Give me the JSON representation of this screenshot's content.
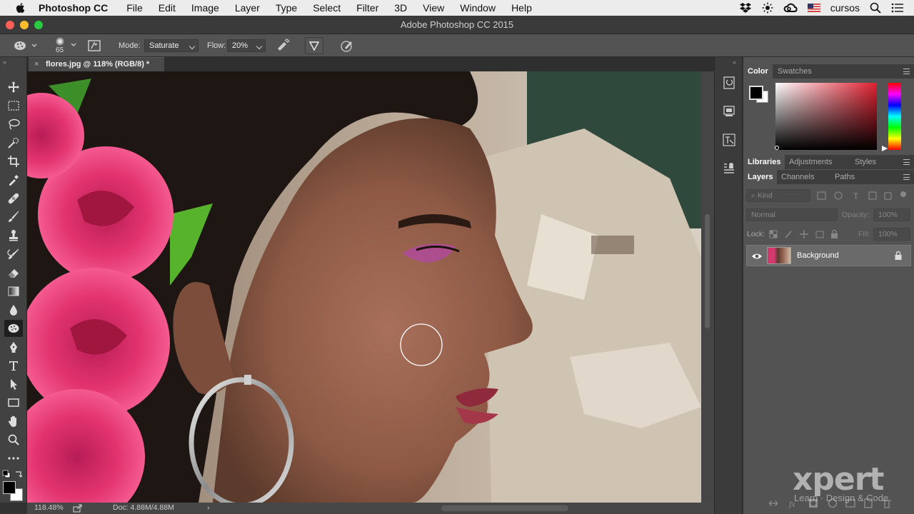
{
  "menubar": {
    "app_name": "Photoshop CC",
    "items": [
      "File",
      "Edit",
      "Image",
      "Layer",
      "Type",
      "Select",
      "Filter",
      "3D",
      "View",
      "Window",
      "Help"
    ],
    "user": "cursos"
  },
  "window": {
    "title": "Adobe Photoshop CC 2015"
  },
  "options_bar": {
    "brush_size": "65",
    "mode_label": "Mode:",
    "mode_value": "Saturate",
    "flow_label": "Flow:",
    "flow_value": "20%"
  },
  "document": {
    "tab_title": "flores.jpg @ 118% (RGB/8) *",
    "close_glyph": "×"
  },
  "status_bar": {
    "zoom": "118.48%",
    "doc_size": "Doc: 4.88M/4.88M",
    "arrow": "›"
  },
  "color_panel": {
    "tabs": [
      "Color",
      "Swatches"
    ],
    "foreground": "#000000",
    "background": "#ffffff",
    "hue": "#e02030"
  },
  "libraries_panel": {
    "tabs": [
      "Libraries",
      "Adjustments",
      "Styles"
    ]
  },
  "layers_panel": {
    "tabs": [
      "Layers",
      "Channels",
      "Paths"
    ],
    "filter_placeholder": "Kind",
    "blend_mode": "Normal",
    "opacity_label": "Opacity:",
    "opacity_value": "100%",
    "lock_label": "Lock:",
    "fill_label": "Fill:",
    "fill_value": "100%",
    "layers": [
      {
        "name": "Background",
        "visible": true,
        "locked": true
      }
    ]
  },
  "watermark": {
    "brand": "xpert",
    "tagline": "Learn · Design & Code"
  },
  "colors": {
    "accent_active_tool": "#1f1f1f",
    "panel_bg": "#535353",
    "toolbar_bg": "#424242"
  }
}
